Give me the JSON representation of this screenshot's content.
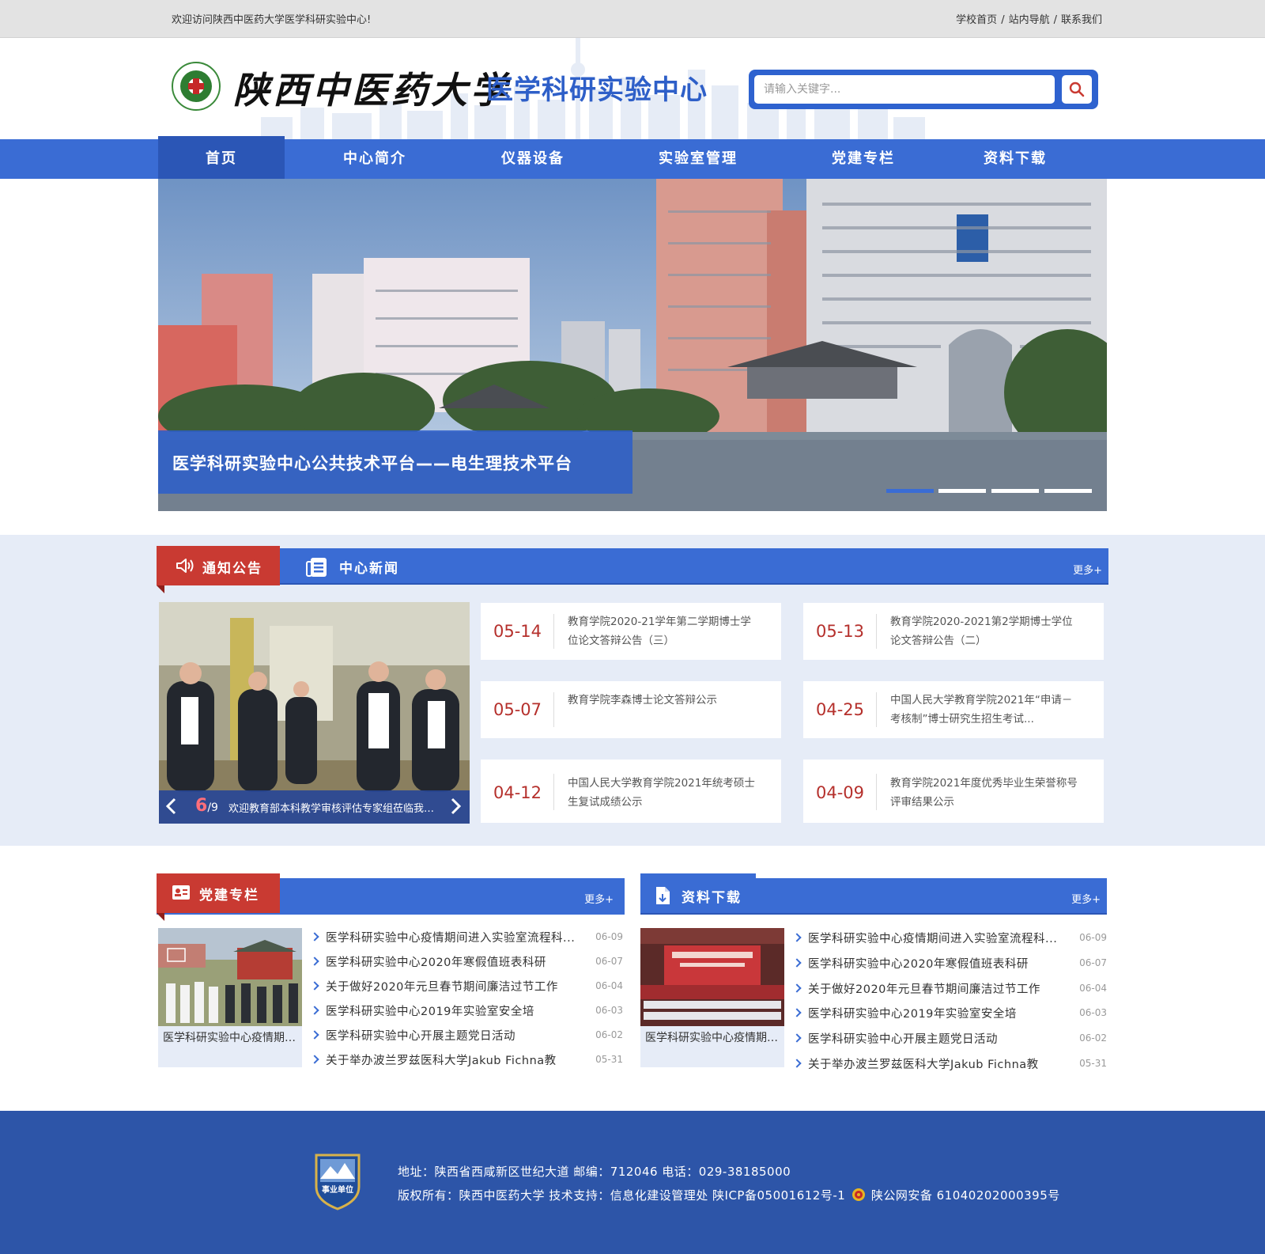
{
  "topbar": {
    "welcome": "欢迎访问陕西中医药大学医学科研实验中心!",
    "links": [
      "学校首页",
      "站内导航",
      "联系我们"
    ],
    "separator": "/"
  },
  "header": {
    "brand_name": "陕西中医药大学",
    "subtitle": "医学科研实验中心",
    "search_placeholder": "请输入关键字..."
  },
  "nav": {
    "items": [
      "首页",
      "中心简介",
      "仪器设备",
      "实验室管理",
      "党建专栏",
      "资料下载"
    ],
    "active_index": 0
  },
  "banner": {
    "caption": "医学科研实验中心公共技术平台——电生理技术平台",
    "slide_count": 4,
    "active_slide": 0
  },
  "notice_section": {
    "tab_notice": "通知公告",
    "tab_news": "中心新闻",
    "more": "更多+",
    "photo": {
      "current": "6",
      "total": "/9",
      "title": "欢迎教育部本科教学审核评估专家组莅临我校指导"
    },
    "items": [
      {
        "date": "05-14",
        "text": "教育学院2020-21学年第二学期博士学位论文答辩公告（三）"
      },
      {
        "date": "05-13",
        "text": "教育学院2020-2021第2学期博士学位论文答辩公告（二）"
      },
      {
        "date": "05-07",
        "text": "教育学院李森博士论文答辩公示"
      },
      {
        "date": "04-25",
        "text": "中国人民大学教育学院2021年“申请－考核制”博士研究生招生考试..."
      },
      {
        "date": "04-12",
        "text": "中国人民大学教育学院2021年统考硕士生复试成绩公示"
      },
      {
        "date": "04-09",
        "text": "教育学院2021年度优秀毕业生荣誉称号评审结果公示"
      }
    ]
  },
  "party_section": {
    "title": "党建专栏",
    "more": "更多+",
    "photo_caption": "医学科研实验中心疫情期间进入实验室流程科...",
    "rows": [
      {
        "title": "医学科研实验中心疫情期间进入实验室流程科...",
        "date": "06-09"
      },
      {
        "title": "医学科研实验中心2020年寒假值班表科研",
        "date": "06-07"
      },
      {
        "title": "关于做好2020年元旦春节期间廉洁过节工作",
        "date": "06-04"
      },
      {
        "title": "医学科研实验中心2019年实验室安全培",
        "date": "06-03"
      },
      {
        "title": "医学科研实验中心开展主题党日活动",
        "date": "06-02"
      },
      {
        "title": "关于举办波兰罗兹医科大学Jakub Fichna教",
        "date": "05-31"
      }
    ]
  },
  "download_section": {
    "title": "资料下载",
    "more": "更多+",
    "photo_caption": "医学科研实验中心疫情期间进入实验室流程科...",
    "rows": [
      {
        "title": "医学科研实验中心疫情期间进入实验室流程科...",
        "date": "06-09"
      },
      {
        "title": "医学科研实验中心2020年寒假值班表科研",
        "date": "06-07"
      },
      {
        "title": "关于做好2020年元旦春节期间廉洁过节工作",
        "date": "06-04"
      },
      {
        "title": "医学科研实验中心2019年实验室安全培",
        "date": "06-03"
      },
      {
        "title": "医学科研实验中心开展主题党日活动",
        "date": "06-02"
      },
      {
        "title": "关于举办波兰罗兹医科大学Jakub Fichna教",
        "date": "05-31"
      }
    ]
  },
  "footer": {
    "badge_text": "事业单位",
    "address_line": "地址：陕西省西咸新区世纪大道 邮编：712046 电话：029-38185000",
    "copyright_line_a": "版权所有：陕西中医药大学 技术支持：信息化建设管理处 陕ICP备05001612号-1",
    "copyright_line_b": "陕公网安备 61040202000395号"
  },
  "colors": {
    "primary_blue": "#3a6cd4",
    "dark_blue": "#2b56b6",
    "accent_red": "#c93a32",
    "date_red": "#b5302c",
    "footer_blue": "#2d55a8",
    "band_bg": "#e6ecf7"
  }
}
